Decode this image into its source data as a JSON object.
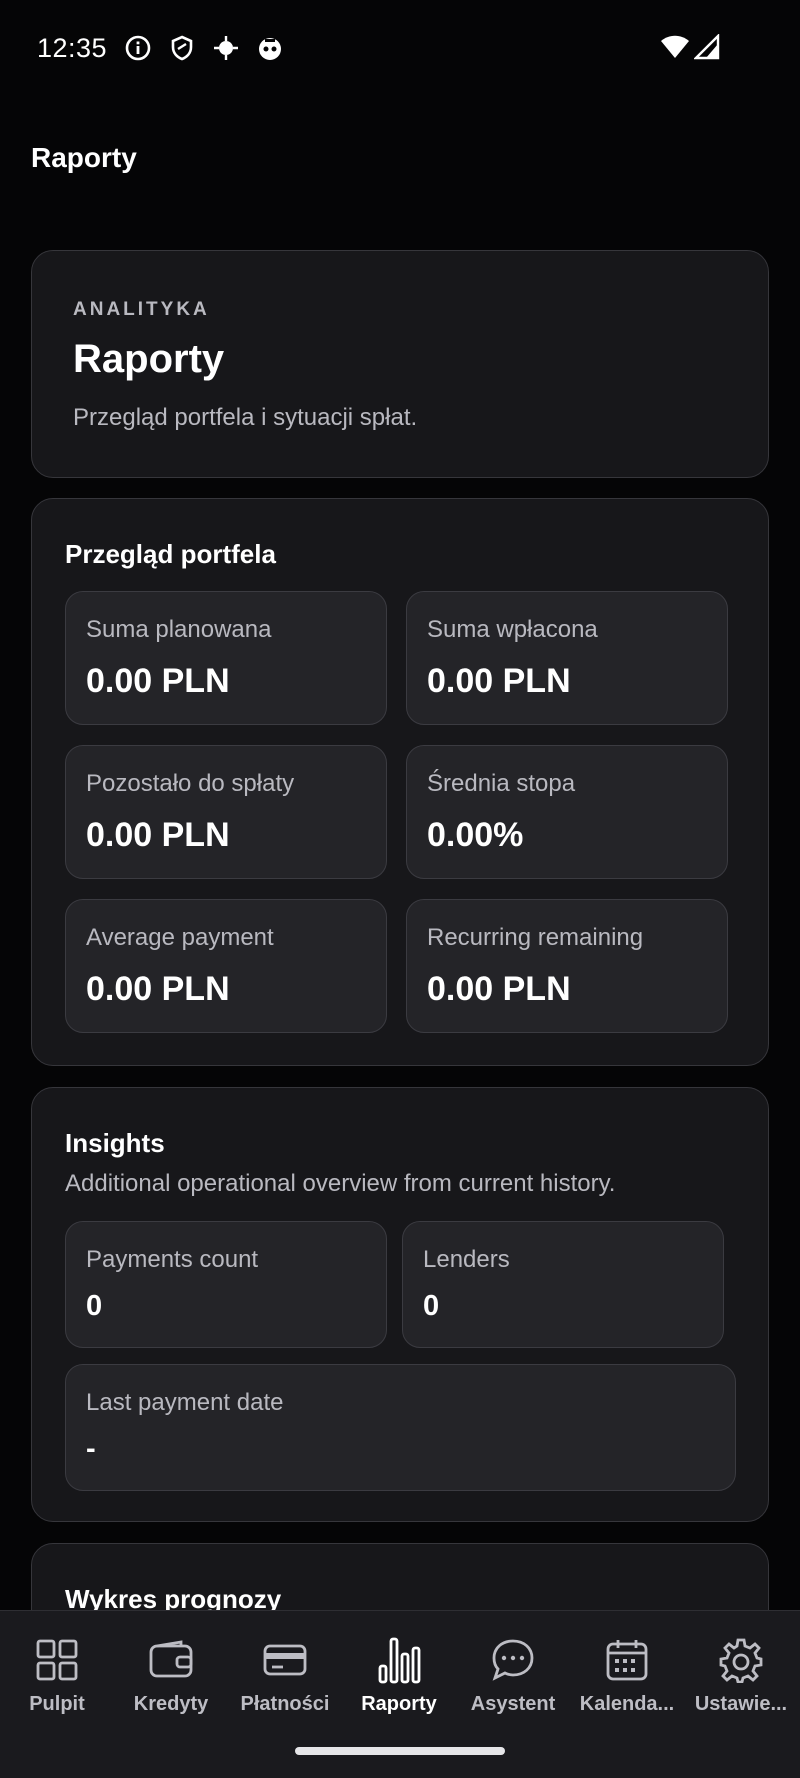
{
  "status_bar": {
    "time": "12:35"
  },
  "app_bar": {
    "title": "Raporty"
  },
  "hero": {
    "eyebrow": "ANALITYKA",
    "title": "Raporty",
    "subtitle": "Przegląd portfela i sytuacji spłat."
  },
  "portfolio": {
    "title": "Przegląd portfela",
    "tiles": [
      {
        "label": "Suma planowana",
        "value": "0.00 PLN"
      },
      {
        "label": "Suma wpłacona",
        "value": "0.00 PLN"
      },
      {
        "label": "Pozostało do spłaty",
        "value": "0.00 PLN"
      },
      {
        "label": "Średnia stopa",
        "value": "0.00%"
      },
      {
        "label": "Average payment",
        "value": "0.00 PLN"
      },
      {
        "label": "Recurring remaining",
        "value": "0.00 PLN"
      }
    ]
  },
  "insights": {
    "title": "Insights",
    "subtitle": "Additional operational overview from current history.",
    "tiles": [
      {
        "label": "Payments count",
        "value": "0"
      },
      {
        "label": "Lenders",
        "value": "0"
      },
      {
        "label": "Last payment date",
        "value": "-"
      }
    ]
  },
  "forecast": {
    "title": "Wykres prognozy"
  },
  "nav": {
    "items": [
      {
        "label": "Pulpit",
        "icon": "grid-icon"
      },
      {
        "label": "Kredyty",
        "icon": "wallet-icon"
      },
      {
        "label": "Płatności",
        "icon": "card-icon"
      },
      {
        "label": "Raporty",
        "icon": "bar-chart-icon"
      },
      {
        "label": "Asystent",
        "icon": "chat-icon"
      },
      {
        "label": "Kalenda...",
        "icon": "calendar-icon"
      },
      {
        "label": "Ustawie...",
        "icon": "gear-icon"
      }
    ],
    "active": "Raporty"
  },
  "colors": {
    "background": "#050506",
    "card": "#17171a",
    "tile": "#242428",
    "accent": "#ffffff"
  }
}
